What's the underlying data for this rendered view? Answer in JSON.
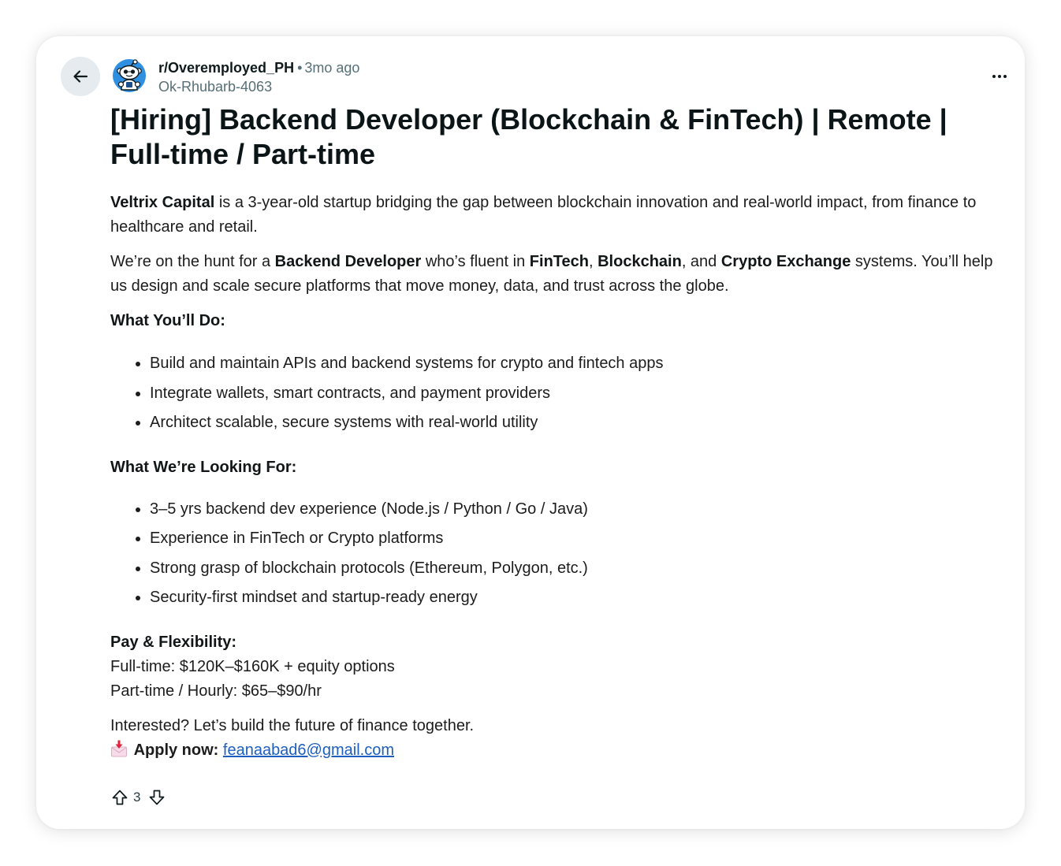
{
  "header": {
    "back_icon": "arrow-left-icon",
    "avatar_icon": "snoo-avatar-icon",
    "subreddit": "r/Overemployed_PH",
    "separator": "•",
    "time_ago": "3mo ago",
    "username": "Ok-Rhubarb-4063",
    "more_icon": "more-horizontal-icon"
  },
  "post": {
    "title": "[Hiring] Backend Developer (Blockchain & FinTech) | Remote | Full-time / Part-time",
    "intro": {
      "company": "Veltrix Capital",
      "text": " is a 3-year-old startup bridging the gap between blockchain innovation and real-world impact, from finance to healthcare and retail."
    },
    "pitch": [
      "We’re on the hunt for a ",
      "Backend Developer",
      " who’s fluent in ",
      "FinTech",
      ", ",
      "Blockchain",
      ", and ",
      "Crypto Exchange",
      " systems. You’ll help us design and scale secure platforms that move money, data, and trust across the globe."
    ],
    "what_you_do": {
      "heading": "What You’ll Do:",
      "items": [
        "Build and maintain APIs and backend systems for crypto and fintech apps",
        "Integrate wallets, smart contracts, and payment providers",
        "Architect scalable, secure systems with real-world utility"
      ]
    },
    "looking_for": {
      "heading": "What We’re Looking For:",
      "items": [
        "3–5 yrs backend dev experience (Node.js / Python / Go / Java)",
        "Experience in FinTech or Crypto platforms",
        "Strong grasp of blockchain protocols (Ethereum, Polygon, etc.)",
        "Security-first mindset and startup-ready energy"
      ]
    },
    "pay": {
      "heading": "Pay & Flexibility:",
      "full_time": "Full-time: $120K–$160K + equity options",
      "part_time": "Part-time / Hourly: $65–$90/hr"
    },
    "closing": {
      "text": "Interested? Let’s build the future of finance together.",
      "apply_icon": "envelope-with-arrow-icon",
      "apply_label": "Apply now:",
      "email": "feanaabad6@gmail.com"
    }
  },
  "votes": {
    "upvote_icon": "upvote-arrow-icon",
    "count": "3",
    "downvote_icon": "downvote-arrow-icon"
  },
  "theme": {
    "text": "#1c1c1c",
    "title": "#0b1416",
    "meta": "#576f76",
    "link": "#1d5fbf",
    "back_button_bg": "#e5ebee",
    "avatar_bg": "#2f8fe0"
  }
}
